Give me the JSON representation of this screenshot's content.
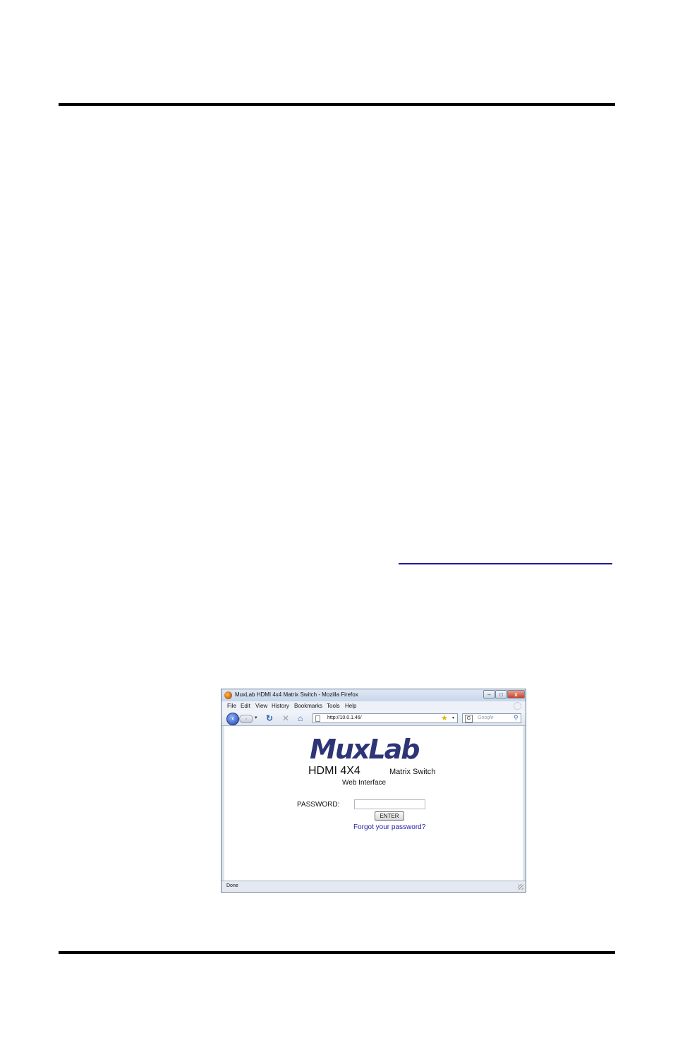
{
  "browser": {
    "title": "MuxLab HDMI 4x4 Matrix Switch - Mozilla Firefox",
    "window_buttons": {
      "minimize": "–",
      "maximize": "□",
      "close": "x"
    },
    "menu": [
      "File",
      "Edit",
      "View",
      "History",
      "Bookmarks",
      "Tools",
      "Help"
    ],
    "nav": {
      "back_icon": "back-arrow-icon",
      "forward_icon": "forward-arrow-icon",
      "reload_icon": "reload-icon",
      "stop_icon": "stop-icon",
      "home_icon": "home-icon"
    },
    "url": "http://10.0.1.46/",
    "search": {
      "engine_icon": "G",
      "placeholder": "Google"
    },
    "status": "Done"
  },
  "page": {
    "logo": "MuxLab",
    "product_main": "HDMI 4X4",
    "product_sub": "Matrix Switch",
    "subtitle": "Web Interface",
    "password_label": "PASSWORD:",
    "password_value": "",
    "enter_button": "ENTER",
    "forgot_link": "Forgot your password?"
  }
}
